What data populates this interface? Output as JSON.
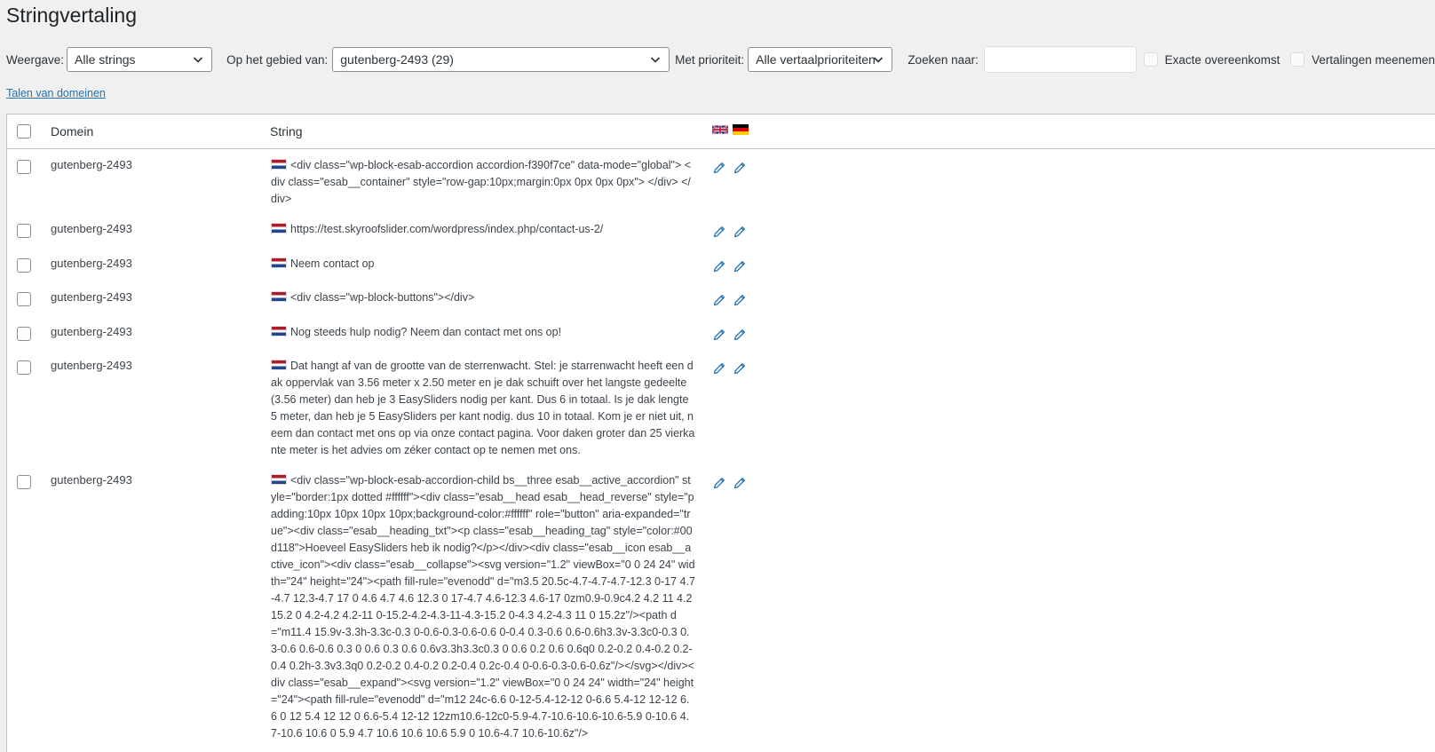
{
  "page": {
    "title": "Stringvertaling"
  },
  "filters": {
    "view_label": "Weergave:",
    "view_value": "Alle strings",
    "domain_label": "Op het gebied van:",
    "domain_value": "gutenberg-2493 (29)",
    "priority_label": "Met prioriteit:",
    "priority_value": "Alle vertaalprioriteiten",
    "search_label": "Zoeken naar:",
    "search_value": "",
    "exact_label": "Exacte overeenkomst",
    "include_translations_label": "Vertalingen meenemen"
  },
  "links": {
    "domain_languages": "Talen van domeinen"
  },
  "table": {
    "col_domain": "Domein",
    "col_string": "String",
    "language_flags": [
      "gb-flag-icon",
      "de-flag-icon"
    ],
    "rows": [
      {
        "domain": "gutenberg-2493",
        "string": "<div class=\"wp-block-esab-accordion accordion-f390f7ce\" data-mode=\"global\"> <div class=\"esab__container\" style=\"row-gap:10px;margin:0px 0px 0px 0px\"> </div> </div>"
      },
      {
        "domain": "gutenberg-2493",
        "string": "https://test.skyroofslider.com/wordpress/index.php/contact-us-2/"
      },
      {
        "domain": "gutenberg-2493",
        "string": "Neem contact op"
      },
      {
        "domain": "gutenberg-2493",
        "string": "<div class=\"wp-block-buttons\"></div>"
      },
      {
        "domain": "gutenberg-2493",
        "string": "Nog steeds hulp nodig? Neem dan contact met ons op!"
      },
      {
        "domain": "gutenberg-2493",
        "string": "Dat hangt af van de grootte van de sterrenwacht. Stel: je starrenwacht heeft een dak oppervlak van 3.56 meter x 2.50 meter en je dak schuift over het langste gedeelte (3.56 meter) dan heb je 3 EasySliders nodig per kant. Dus 6 in totaal. Is je dak lengte 5 meter, dan heb je 5 EasySliders per kant nodig. dus 10 in totaal. Kom je er niet uit, neem dan contact met ons op via onze contact pagina. Voor daken groter dan 25 vierkante meter is het advies om zéker contact op te nemen met ons."
      },
      {
        "domain": "gutenberg-2493",
        "string": "<div class=\"wp-block-esab-accordion-child bs__three esab__active_accordion\" style=\"border:1px dotted #ffffff\"><div class=\"esab__head esab__head_reverse\" style=\"padding:10px 10px 10px 10px;background-color:#ffffff\" role=\"button\" aria-expanded=\"true\"><div class=\"esab__heading_txt\"><p class=\"esab__heading_tag\" style=\"color:#00d118\">Hoeveel EasySliders heb ik nodig?</p></div><div class=\"esab__icon esab__active_icon\"><div class=\"esab__collapse\"><svg version=\"1.2\" viewBox=\"0 0 24 24\" width=\"24\" height=\"24\"><path fill-rule=\"evenodd\" d=\"m3.5 20.5c-4.7-4.7-4.7-12.3 0-17 4.7-4.7 12.3-4.7 17 0 4.6 4.7 4.6 12.3 0 17-4.7 4.6-12.3 4.6-17 0zm0.9-0.9c4.2 4.2 11 4.2 15.2 0 4.2-4.2 4.2-11 0-15.2-4.2-4.3-11-4.3-15.2 0-4.3 4.2-4.3 11 0 15.2z\"/><path d=\"m11.4 15.9v-3.3h-3.3c-0.3 0-0.6-0.3-0.6-0.6 0-0.4 0.3-0.6 0.6-0.6h3.3v-3.3c0-0.3 0.3-0.6 0.6-0.6 0.3 0 0.6 0.3 0.6 0.6v3.3h3.3c0.3 0 0.6 0.2 0.6 0.6q0 0.2-0.2 0.4-0.2 0.2-0.4 0.2h-3.3v3.3q0 0.2-0.2 0.4-0.2 0.2-0.4 0.2c-0.4 0-0.6-0.3-0.6-0.6z\"/></svg></div><div class=\"esab__expand\"><svg version=\"1.2\" viewBox=\"0 0 24 24\" width=\"24\" height=\"24\"><path fill-rule=\"evenodd\" d=\"m12 24c-6.6 0-12-5.4-12-12 0-6.6 5.4-12 12-12 6.6 0 12 5.4 12 12 0 6.6-5.4 12-12 12zm10.6-12c0-5.9-4.7-10.6-10.6-10.6-5.9 0-10.6 4.7-10.6 10.6 0 5.9 4.7 10.6 10.6 10.6 5.9 0 10.6-4.7 10.6-10.6z\"/>"
      }
    ]
  }
}
